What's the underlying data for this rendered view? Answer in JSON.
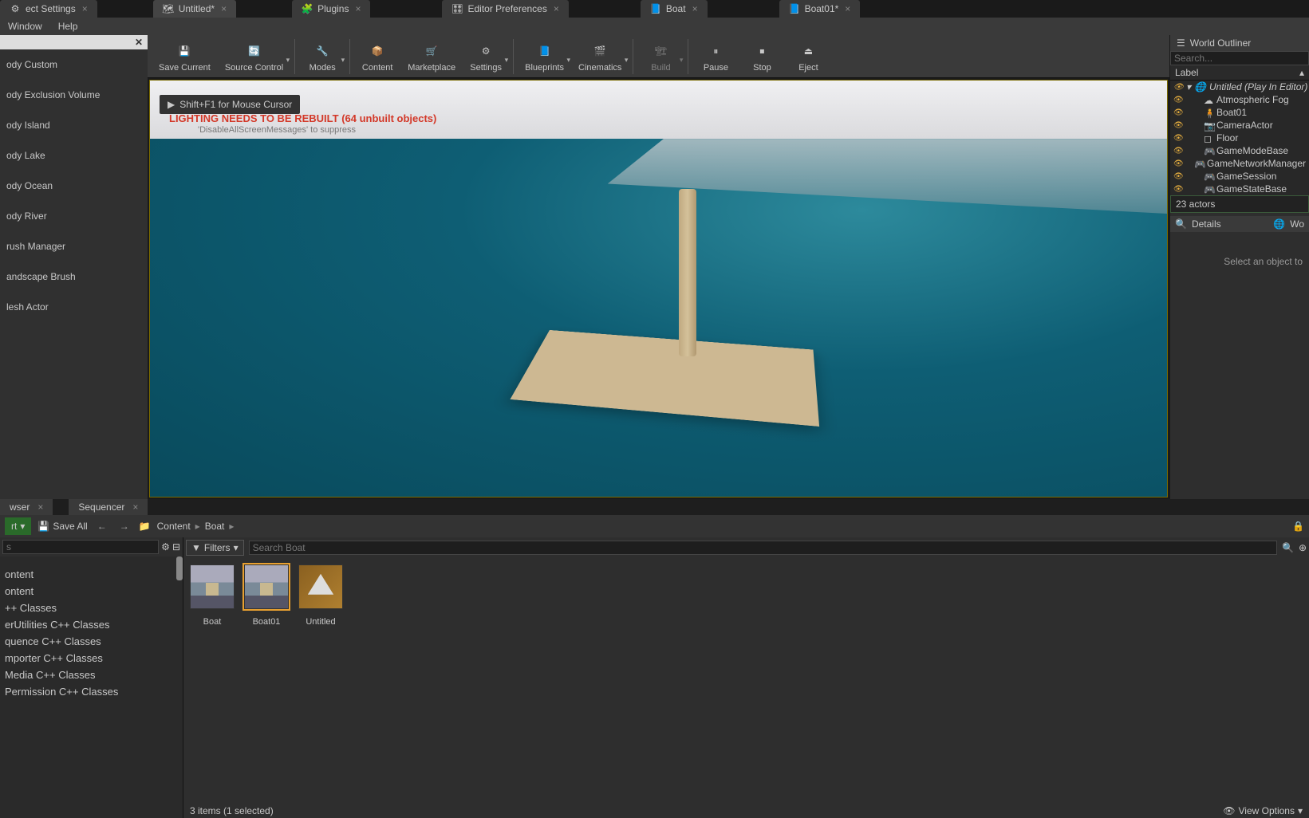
{
  "top_tabs": [
    {
      "label": "ect Settings",
      "icon": "gear"
    },
    {
      "label": "Untitled*",
      "icon": "level"
    },
    {
      "label": "Plugins",
      "icon": "plugin"
    },
    {
      "label": "Editor Preferences",
      "icon": "prefs"
    },
    {
      "label": "Boat",
      "icon": "blueprint"
    },
    {
      "label": "Boat01*",
      "icon": "blueprint"
    }
  ],
  "menu": [
    "Window",
    "Help"
  ],
  "left_panel": {
    "items": [
      "ody Custom",
      "ody Exclusion Volume",
      "ody Island",
      "ody Lake",
      "ody Ocean",
      "ody River",
      "rush Manager",
      "andscape Brush",
      "lesh Actor"
    ]
  },
  "toolbar": [
    {
      "label": "Save Current",
      "icon": "save",
      "drop": false
    },
    {
      "label": "Source Control",
      "icon": "source",
      "drop": true
    },
    {
      "label": "Modes",
      "icon": "modes",
      "drop": true,
      "sep_before": true
    },
    {
      "label": "Content",
      "icon": "content",
      "drop": false,
      "sep_before": true
    },
    {
      "label": "Marketplace",
      "icon": "market",
      "drop": false
    },
    {
      "label": "Settings",
      "icon": "settings",
      "drop": true
    },
    {
      "label": "Blueprints",
      "icon": "blueprint",
      "drop": true,
      "sep_before": true
    },
    {
      "label": "Cinematics",
      "icon": "cinema",
      "drop": true
    },
    {
      "label": "Build",
      "icon": "build",
      "drop": true,
      "sep_before": true,
      "disabled": true
    },
    {
      "label": "Pause",
      "icon": "pause",
      "drop": false,
      "sep_before": true
    },
    {
      "label": "Stop",
      "icon": "stop",
      "drop": false
    },
    {
      "label": "Eject",
      "icon": "eject",
      "drop": false
    }
  ],
  "viewport": {
    "hint": "Shift+F1 for Mouse Cursor",
    "lighting_warn": "LIGHTING NEEDS TO BE REBUILT (64 unbuilt objects)",
    "suppress": "'DisableAllScreenMessages' to suppress"
  },
  "outliner": {
    "title": "World Outliner",
    "search_placeholder": "Search...",
    "label_col": "Label",
    "world": "Untitled (Play In Editor)",
    "rows": [
      {
        "label": "Atmospheric Fog",
        "icon": "fog"
      },
      {
        "label": "Boat01",
        "icon": "pawn"
      },
      {
        "label": "CameraActor",
        "icon": "camera"
      },
      {
        "label": "Floor",
        "icon": "mesh"
      },
      {
        "label": "GameModeBase",
        "icon": "gm"
      },
      {
        "label": "GameNetworkManager",
        "icon": "gm"
      },
      {
        "label": "GameSession",
        "icon": "gm"
      },
      {
        "label": "GameStateBase",
        "icon": "gm"
      }
    ],
    "count": "23 actors"
  },
  "details": {
    "title": "Details",
    "world_tab": "Wo",
    "empty": "Select an object to"
  },
  "bottom_tabs": [
    "wser",
    "Sequencer"
  ],
  "cb": {
    "add": "rt",
    "save_all": "Save All",
    "crumbs": [
      "Content",
      "Boat"
    ],
    "src_search_placeholder": "s",
    "sources": [
      "ontent",
      "ontent",
      "++ Classes",
      "erUtilities C++ Classes",
      "quence C++ Classes",
      "mporter C++ Classes",
      "Media C++ Classes",
      "Permission C++ Classes"
    ],
    "filters": "Filters",
    "asset_search_placeholder": "Search Boat",
    "assets": [
      {
        "label": "Boat",
        "type": "boat"
      },
      {
        "label": "Boat01",
        "type": "boat",
        "selected": true
      },
      {
        "label": "Untitled",
        "type": "untitled"
      }
    ],
    "status": "3 items (1 selected)",
    "view_options": "View Options"
  }
}
